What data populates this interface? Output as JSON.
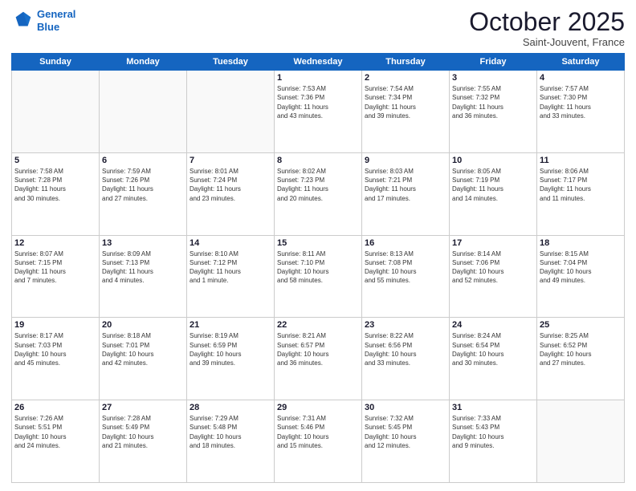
{
  "logo": {
    "line1": "General",
    "line2": "Blue"
  },
  "header": {
    "month": "October 2025",
    "location": "Saint-Jouvent, France"
  },
  "weekdays": [
    "Sunday",
    "Monday",
    "Tuesday",
    "Wednesday",
    "Thursday",
    "Friday",
    "Saturday"
  ],
  "weeks": [
    [
      {
        "day": "",
        "info": ""
      },
      {
        "day": "",
        "info": ""
      },
      {
        "day": "",
        "info": ""
      },
      {
        "day": "1",
        "info": "Sunrise: 7:53 AM\nSunset: 7:36 PM\nDaylight: 11 hours\nand 43 minutes."
      },
      {
        "day": "2",
        "info": "Sunrise: 7:54 AM\nSunset: 7:34 PM\nDaylight: 11 hours\nand 39 minutes."
      },
      {
        "day": "3",
        "info": "Sunrise: 7:55 AM\nSunset: 7:32 PM\nDaylight: 11 hours\nand 36 minutes."
      },
      {
        "day": "4",
        "info": "Sunrise: 7:57 AM\nSunset: 7:30 PM\nDaylight: 11 hours\nand 33 minutes."
      }
    ],
    [
      {
        "day": "5",
        "info": "Sunrise: 7:58 AM\nSunset: 7:28 PM\nDaylight: 11 hours\nand 30 minutes."
      },
      {
        "day": "6",
        "info": "Sunrise: 7:59 AM\nSunset: 7:26 PM\nDaylight: 11 hours\nand 27 minutes."
      },
      {
        "day": "7",
        "info": "Sunrise: 8:01 AM\nSunset: 7:24 PM\nDaylight: 11 hours\nand 23 minutes."
      },
      {
        "day": "8",
        "info": "Sunrise: 8:02 AM\nSunset: 7:23 PM\nDaylight: 11 hours\nand 20 minutes."
      },
      {
        "day": "9",
        "info": "Sunrise: 8:03 AM\nSunset: 7:21 PM\nDaylight: 11 hours\nand 17 minutes."
      },
      {
        "day": "10",
        "info": "Sunrise: 8:05 AM\nSunset: 7:19 PM\nDaylight: 11 hours\nand 14 minutes."
      },
      {
        "day": "11",
        "info": "Sunrise: 8:06 AM\nSunset: 7:17 PM\nDaylight: 11 hours\nand 11 minutes."
      }
    ],
    [
      {
        "day": "12",
        "info": "Sunrise: 8:07 AM\nSunset: 7:15 PM\nDaylight: 11 hours\nand 7 minutes."
      },
      {
        "day": "13",
        "info": "Sunrise: 8:09 AM\nSunset: 7:13 PM\nDaylight: 11 hours\nand 4 minutes."
      },
      {
        "day": "14",
        "info": "Sunrise: 8:10 AM\nSunset: 7:12 PM\nDaylight: 11 hours\nand 1 minute."
      },
      {
        "day": "15",
        "info": "Sunrise: 8:11 AM\nSunset: 7:10 PM\nDaylight: 10 hours\nand 58 minutes."
      },
      {
        "day": "16",
        "info": "Sunrise: 8:13 AM\nSunset: 7:08 PM\nDaylight: 10 hours\nand 55 minutes."
      },
      {
        "day": "17",
        "info": "Sunrise: 8:14 AM\nSunset: 7:06 PM\nDaylight: 10 hours\nand 52 minutes."
      },
      {
        "day": "18",
        "info": "Sunrise: 8:15 AM\nSunset: 7:04 PM\nDaylight: 10 hours\nand 49 minutes."
      }
    ],
    [
      {
        "day": "19",
        "info": "Sunrise: 8:17 AM\nSunset: 7:03 PM\nDaylight: 10 hours\nand 45 minutes."
      },
      {
        "day": "20",
        "info": "Sunrise: 8:18 AM\nSunset: 7:01 PM\nDaylight: 10 hours\nand 42 minutes."
      },
      {
        "day": "21",
        "info": "Sunrise: 8:19 AM\nSunset: 6:59 PM\nDaylight: 10 hours\nand 39 minutes."
      },
      {
        "day": "22",
        "info": "Sunrise: 8:21 AM\nSunset: 6:57 PM\nDaylight: 10 hours\nand 36 minutes."
      },
      {
        "day": "23",
        "info": "Sunrise: 8:22 AM\nSunset: 6:56 PM\nDaylight: 10 hours\nand 33 minutes."
      },
      {
        "day": "24",
        "info": "Sunrise: 8:24 AM\nSunset: 6:54 PM\nDaylight: 10 hours\nand 30 minutes."
      },
      {
        "day": "25",
        "info": "Sunrise: 8:25 AM\nSunset: 6:52 PM\nDaylight: 10 hours\nand 27 minutes."
      }
    ],
    [
      {
        "day": "26",
        "info": "Sunrise: 7:26 AM\nSunset: 5:51 PM\nDaylight: 10 hours\nand 24 minutes."
      },
      {
        "day": "27",
        "info": "Sunrise: 7:28 AM\nSunset: 5:49 PM\nDaylight: 10 hours\nand 21 minutes."
      },
      {
        "day": "28",
        "info": "Sunrise: 7:29 AM\nSunset: 5:48 PM\nDaylight: 10 hours\nand 18 minutes."
      },
      {
        "day": "29",
        "info": "Sunrise: 7:31 AM\nSunset: 5:46 PM\nDaylight: 10 hours\nand 15 minutes."
      },
      {
        "day": "30",
        "info": "Sunrise: 7:32 AM\nSunset: 5:45 PM\nDaylight: 10 hours\nand 12 minutes."
      },
      {
        "day": "31",
        "info": "Sunrise: 7:33 AM\nSunset: 5:43 PM\nDaylight: 10 hours\nand 9 minutes."
      },
      {
        "day": "",
        "info": ""
      }
    ]
  ]
}
